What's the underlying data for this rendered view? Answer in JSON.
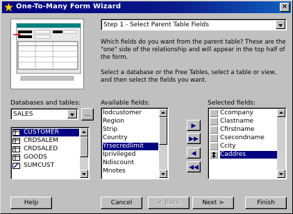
{
  "window": {
    "title": "One-To-Many Form Wizard",
    "close_label": "×"
  },
  "step_select": {
    "value": "Step 1 - Select Parent Table Fields"
  },
  "description": {
    "line1": "Which fields do you want from the parent table? These are the \"one\" side of the relationship and will appear in the top half of the form.",
    "line2": "Select a database or the Free Tables, select a table or view, and then select the fields you want."
  },
  "databases": {
    "label": "Databases and tables:",
    "selected_db": "SALES",
    "browse_label": "...",
    "tables": [
      "CUSTOMER",
      "CRDSALEM",
      "CRDSALED",
      "GOODS",
      "SUMCUST"
    ],
    "selected_index": 0
  },
  "available_fields": {
    "label": "Available fields:",
    "items": [
      "lodcustomer",
      "Region",
      "Strip",
      "Country",
      "Yrsecredlimit",
      "Iprivileged",
      "Ndiscount",
      "Mnotes"
    ],
    "selected_index": 4
  },
  "move_buttons": {
    "add": "▶",
    "add_all": "▶▶",
    "remove": "◀",
    "remove_all": "◀◀"
  },
  "selected_fields": {
    "label": "Selected fields:",
    "items": [
      "Ccompany",
      "Clastname",
      "Cfirstname",
      "Csecondname",
      "Ccity",
      "Caddres"
    ],
    "selected_index": 5
  },
  "buttons": {
    "help": "Help",
    "cancel": "Cancel",
    "back": "< Back",
    "next": "Next >",
    "finish": "Finish"
  },
  "colors": {
    "title_bar": "#000080",
    "selection": "#000080",
    "face": "#c0c0c0"
  }
}
